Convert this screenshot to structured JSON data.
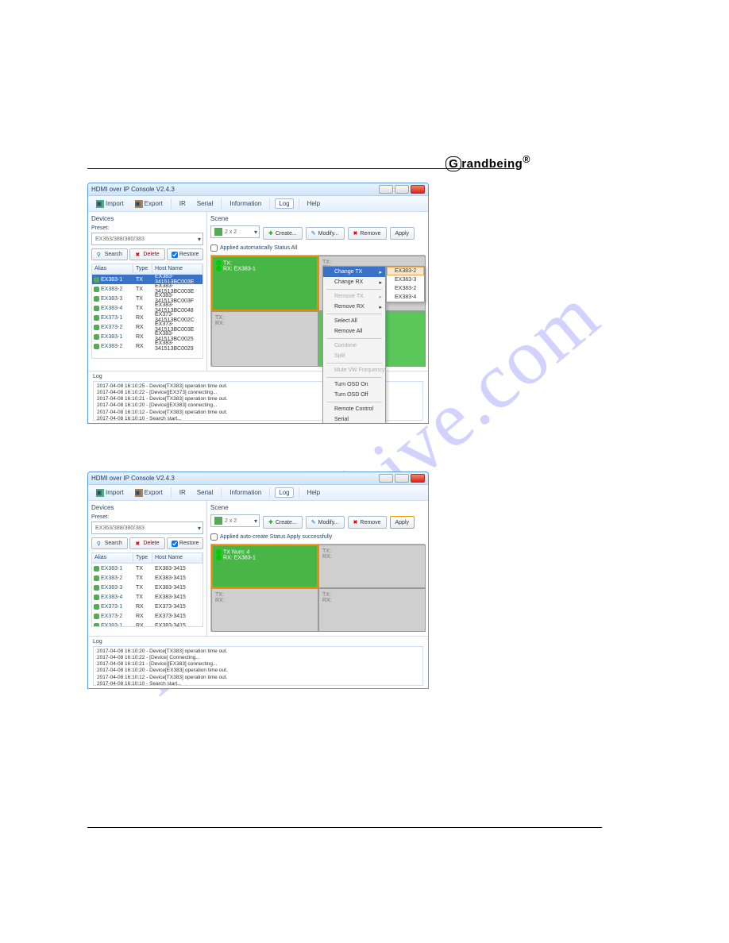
{
  "brand": "Grandbeing®",
  "watermark": "manualshive.com",
  "shared": {
    "win_title": "HDMI over IP Console V2.4.3",
    "toolbar": {
      "import": "Import",
      "export": "Export",
      "ir": "IR",
      "serial": "Serial",
      "information": "Information",
      "log": "Log",
      "help": "Help"
    },
    "devices_label": "Devices",
    "preset_label": "Preset:",
    "search": "Search",
    "delete": "Delete",
    "restore": "Restore",
    "cols": {
      "alias": "Alias",
      "type": "Type",
      "hostname": "Host Name"
    },
    "rows": [
      {
        "alias": "EX383-1",
        "type": "TX",
        "host": "EX383-341513BC003E"
      },
      {
        "alias": "EX383-2",
        "type": "TX",
        "host": "EX383-341513BC003E"
      },
      {
        "alias": "EX383-3",
        "type": "TX",
        "host": "EX383-341513BC003F"
      },
      {
        "alias": "EX383-4",
        "type": "TX",
        "host": "EX383-341513BC0048"
      },
      {
        "alias": "EX373-1",
        "type": "RX",
        "host": "EX373-341513BC002C"
      },
      {
        "alias": "EX373-2",
        "type": "RX",
        "host": "EX373-341513BC003E"
      },
      {
        "alias": "EX383-1",
        "type": "RX",
        "host": "EX383-341513BC0025"
      },
      {
        "alias": "EX383-2",
        "type": "RX",
        "host": "EX383-341513BC0029"
      }
    ],
    "scene_label": "Scene",
    "layout_combo": "2 x 2",
    "create": "Create...",
    "modify": "Modify...",
    "remove": "Remove",
    "apply": "Apply",
    "auto_chk": "Applied automatically   Status",
    "log_label": "Log"
  },
  "s1": {
    "preset_value": "EX363/388/380/383",
    "chk_label": "Applied automatically   Status    All",
    "cells": {
      "tl_tx": "TX:",
      "tl_rx": "RX: EX383-1",
      "tr_tx": "TX:",
      "tr_rx": "RX:",
      "bl_tx": "TX:",
      "bl_rx": "RX:"
    },
    "menu": {
      "change_tx": "Change TX",
      "change_rx": "Change RX",
      "remove_tx": "Remove TX",
      "remove_rx": "Remove RX",
      "select_all": "Select All",
      "remove_all": "Remove All",
      "combine": "Combine",
      "split": "Split",
      "mute_vw": "Mute VW Frequency",
      "osd_on": "Turn OSD On",
      "osd_off": "Turn OSD Off",
      "remote_ctrl": "Remote Control",
      "serial": "Serial"
    },
    "submenu": [
      "EX383-2",
      "EX383-3",
      "EX383-2",
      "EX383-4"
    ],
    "log_lines": [
      "2017-04-08 16:10:25 - Device[TX383] operation time out.",
      "2017-04-08 16:10:22 - [Device][EX373] connecting...",
      "2017-04-08 16:10:21 - Device[TX383] operation time out.",
      "2017-04-08 16:10:20 - [Device][EX383] connecting...",
      "2017-04-08 16:10:12 - Device[TX383] operation time out.",
      "2017-04-08 16:10:10 - Search start..."
    ]
  },
  "s2": {
    "preset_value": "EX363/388/380/383",
    "chk_label": "Applied auto-create   Status    Apply successfully",
    "cells": {
      "tl_tx": "TX Num: 4",
      "tl_rx": "RX: EX383-1",
      "tr_tx": "TX:",
      "tr_rx": "RX:",
      "bl_tx": "TX:",
      "bl_rx": "RX:",
      "br_tx": "TX:",
      "br_rx": "RX:"
    },
    "log_lines": [
      "2017-04-08 16:10:20 - Device[TX383] operation time out.",
      "2017-04-08 16:10:22 - [Device] Connecting...",
      "2017-04-08 16:10:21 - [Device][EX383] connecting...",
      "2017-04-08 16:10:20 - Device[EX383] operation time out.",
      "2017-04-08 16:10:12 - Device[TX383] operation time out.",
      "2017-04-08 16:10:10 - Search start..."
    ]
  }
}
